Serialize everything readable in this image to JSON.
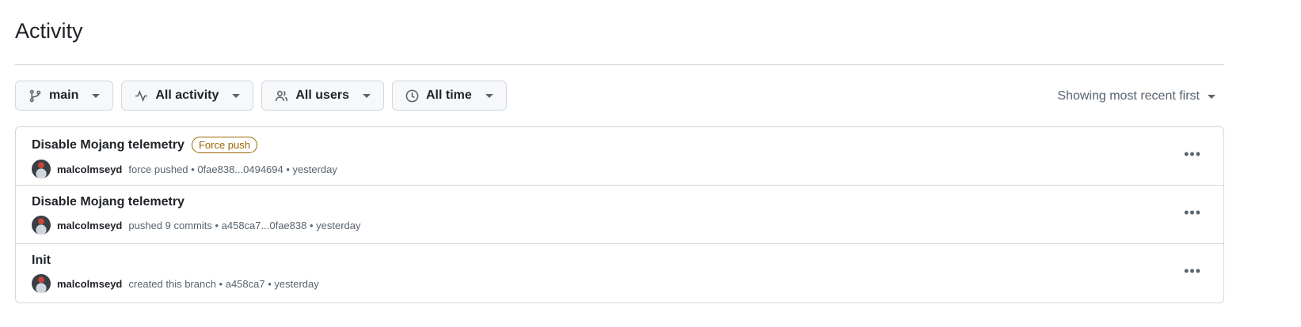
{
  "header": {
    "title": "Activity"
  },
  "filters": [
    {
      "label": "main",
      "icon": "git-branch-icon"
    },
    {
      "label": "All activity",
      "icon": "pulse-icon"
    },
    {
      "label": "All users",
      "icon": "people-icon"
    },
    {
      "label": "All time",
      "icon": "clock-icon"
    }
  ],
  "sort": {
    "label": "Showing most recent first"
  },
  "activities": [
    {
      "title": "Disable Mojang telemetry",
      "badge": "Force push",
      "user": "malcolmseyd",
      "detail": "force pushed • 0fae838...0494694 • yesterday"
    },
    {
      "title": "Disable Mojang telemetry",
      "user": "malcolmseyd",
      "detail": "pushed 9 commits • a458ca7...0fae838 • yesterday"
    },
    {
      "title": "Init",
      "user": "malcolmseyd",
      "detail": "created this branch • a458ca7 • yesterday"
    }
  ],
  "colors": {
    "badge": "#9a6700",
    "border": "#d1d9e0",
    "muted": "#59636e"
  }
}
